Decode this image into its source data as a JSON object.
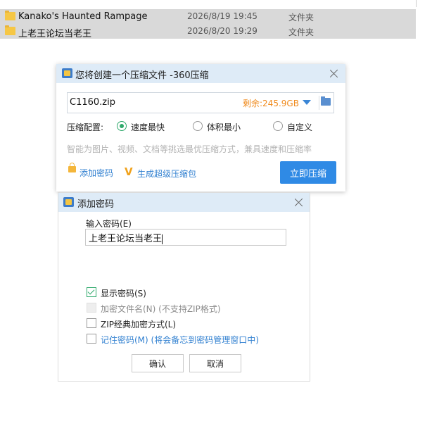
{
  "file_list": [
    {
      "name": "Kanako's Haunted Rampage",
      "date": "2026/8/19 19:45",
      "type": "文件夹"
    },
    {
      "name": "上老王论坛当老王",
      "date": "2026/8/20 19:29",
      "type": "文件夹"
    }
  ],
  "compress_dialog": {
    "title": "您将创建一个压缩文件 -360压缩",
    "filename": "C1160.zip",
    "free_space": "剩余:245.9GB",
    "config_label": "压缩配置:",
    "options": [
      {
        "label": "速度最快",
        "selected": true
      },
      {
        "label": "体积最小",
        "selected": false
      },
      {
        "label": "自定义",
        "selected": false
      }
    ],
    "hint": "智能为图片、视频、文档等挑选最优压缩方式，兼具速度和压缩率",
    "add_password_link": "添加密码",
    "sfx_link": "生成超级压缩包",
    "compress_button": "立即压缩"
  },
  "password_dialog": {
    "title": "添加密码",
    "input_label": "输入密码(E)",
    "password_value": "上老王论坛当老王",
    "checkboxes": [
      {
        "label": "显示密码(S)",
        "checked": true,
        "disabled": false
      },
      {
        "label": "加密文件名(N) (不支持ZIP格式)",
        "checked": false,
        "disabled": true
      },
      {
        "label": "ZIP经典加密方式(L)",
        "checked": false,
        "disabled": false
      },
      {
        "label": "记住密码(M) (将会备忘到密码管理窗口中)",
        "checked": false,
        "disabled": false
      }
    ],
    "ok_button": "确认",
    "cancel_button": "取消"
  },
  "colors": {
    "accent_blue": "#2f8ae5",
    "selection_green": "#2fa96b",
    "free_space_orange": "#f08a1c",
    "titlebar_bg": "#deebf7"
  }
}
